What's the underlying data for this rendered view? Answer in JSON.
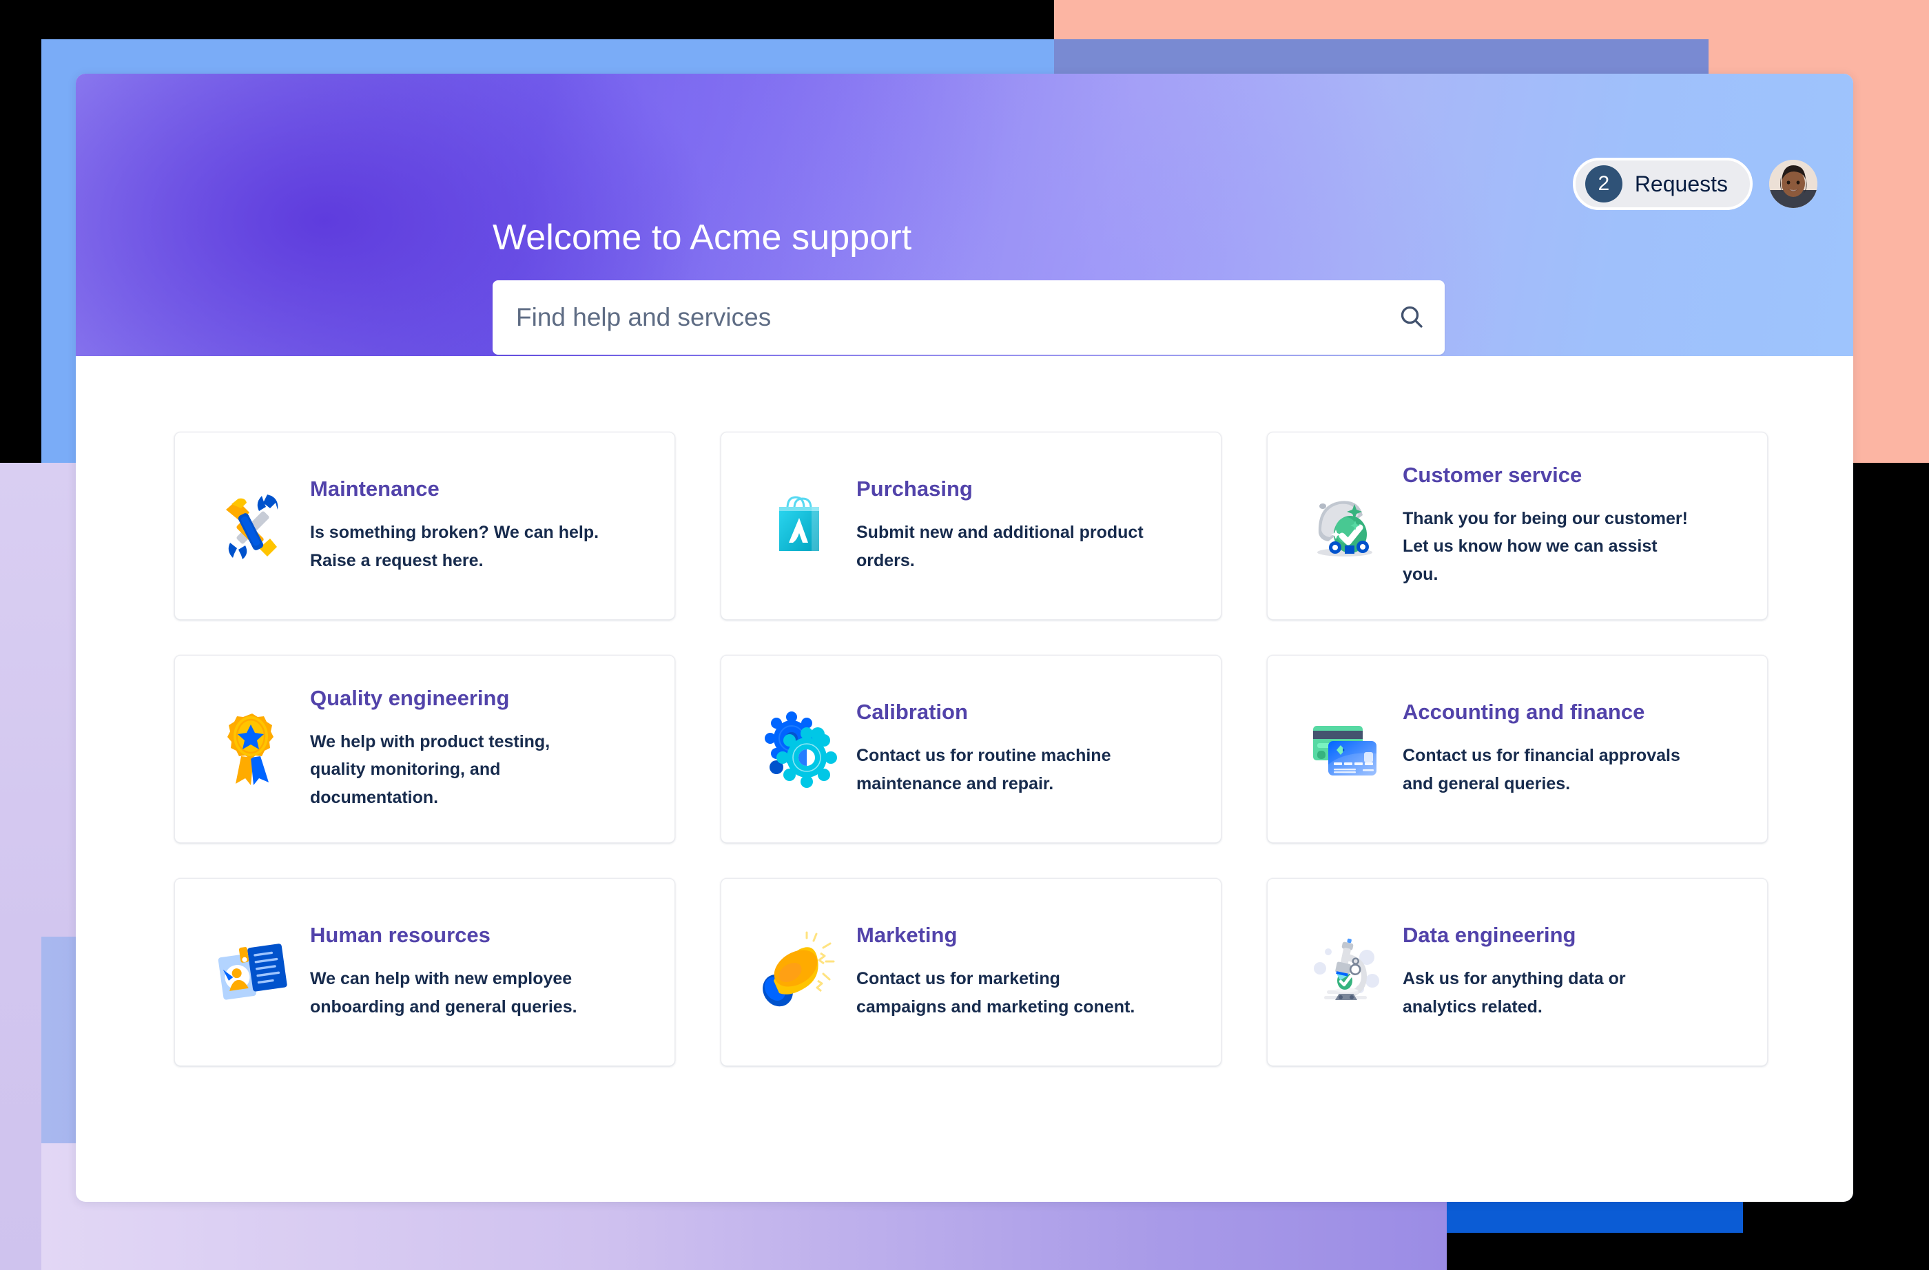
{
  "header": {
    "title": "Welcome to Acme support",
    "search": {
      "placeholder": "Find help and services",
      "value": "",
      "icon": "search-icon"
    },
    "requests": {
      "count": "2",
      "label": "Requests"
    },
    "avatar_alt": "user-avatar"
  },
  "colors": {
    "card_title": "#5243AA",
    "card_body": "#172B4D",
    "badge_bg": "#2F5277",
    "pill_bg": "#EBECF0",
    "hero_gradient_from": "#6B57E8",
    "hero_gradient_to": "#9EC4FD",
    "deco_peach": "#FCB5A3",
    "deco_blue": "#7AACF7",
    "deco_blue_strong": "#0B5CD5",
    "deco_lavender": "#D2C6EF"
  },
  "cards": [
    {
      "id": "maintenance",
      "icon": "hammer-and-wrench-icon",
      "title": "Maintenance",
      "description": "Is something broken? We can help. Raise a request here."
    },
    {
      "id": "purchasing",
      "icon": "shopping-bag-icon",
      "title": "Purchasing",
      "description": "Submit new and additional product orders."
    },
    {
      "id": "customer-service",
      "icon": "serving-dome-check-icon",
      "title": "Customer service",
      "description": "Thank you for being our customer! Let us know how we can assist you."
    },
    {
      "id": "quality-engineering",
      "icon": "award-ribbon-icon",
      "title": "Quality engineering",
      "description": "We help with product testing, quality monitoring, and documentation."
    },
    {
      "id": "calibration",
      "icon": "gears-icon",
      "title": "Calibration",
      "description": "Contact us for routine machine maintenance and repair."
    },
    {
      "id": "accounting-and-finance",
      "icon": "credit-cards-icon",
      "title": "Accounting and finance",
      "description": "Contact us for financial approvals and general queries."
    },
    {
      "id": "human-resources",
      "icon": "id-badge-document-icon",
      "title": "Human resources",
      "description": "We can help with new employee onboarding and general queries."
    },
    {
      "id": "marketing",
      "icon": "megaphone-icon",
      "title": "Marketing",
      "description": "Contact us for marketing campaigns and marketing conent."
    },
    {
      "id": "data-engineering",
      "icon": "microscope-icon",
      "title": "Data engineering",
      "description": "Ask us for anything data or analytics related."
    }
  ]
}
